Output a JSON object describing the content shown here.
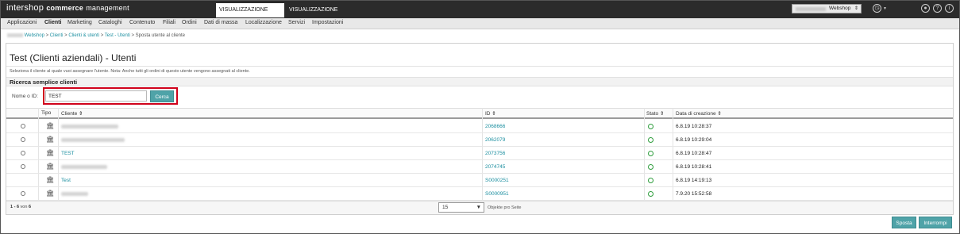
{
  "header": {
    "brand_part1": "intershop",
    "brand_part2": "commerce",
    "brand_part3": "management",
    "tab_data": "VISUALIZZAZIONE DATI",
    "tab_design": "VISUALIZZAZIONE DESIGN",
    "site_select_value": "Webshop",
    "icons": [
      "clock-icon",
      "user-icon",
      "help-icon",
      "info-icon"
    ]
  },
  "nav": {
    "items": [
      "Applicazioni",
      "Clienti",
      "Marketing",
      "Cataloghi",
      "Contenuto",
      "Filiali",
      "Ordini",
      "Dati di massa",
      "Localizzazione",
      "Servizi",
      "Impostazioni"
    ],
    "active": "Clienti"
  },
  "breadcrumb": {
    "items": [
      "Webshop",
      "Clienti",
      "Clienti & utenti",
      "Test - Utenti"
    ],
    "current": "Sposta utente al cliente",
    "sep": ">"
  },
  "page": {
    "title": "Test (Clienti aziendali) - Utenti",
    "hint": "Seleziona il cliente al quale vuoi assegnare l'utente. Nota: Anche tutti gli ordini di questo utente vengono assegnati al cliente."
  },
  "search": {
    "section_title": "Ricerca semplice clienti",
    "label": "Nome o ID:",
    "value": "TEST",
    "button": "Cerca"
  },
  "table": {
    "headers": {
      "tipo": "Tipo",
      "cliente": "Cliente ⇕",
      "id": "ID ⇕",
      "stato": "Stato ⇕",
      "data": "Data di creazione ⇕"
    },
    "rows": [
      {
        "radio": true,
        "cliente": "",
        "id": "2068666",
        "date": "6.8.19 10:28:37"
      },
      {
        "radio": true,
        "cliente": "",
        "id": "2062079",
        "date": "6.8.19 10:29:04"
      },
      {
        "radio": true,
        "cliente": "TEST",
        "id": "2073756",
        "date": "6.8.19 10:28:47"
      },
      {
        "radio": true,
        "cliente": "",
        "id": "2074745",
        "date": "6.8.19 10:28:41"
      },
      {
        "radio": false,
        "cliente": "Test",
        "id": "S0000251",
        "date": "6.8.19 14:19:13"
      },
      {
        "radio": true,
        "cliente": "",
        "id": "S0000951",
        "date": "7.9.20 15:52:58"
      }
    ]
  },
  "pagination": {
    "range": "1 - 6",
    "of": "von",
    "total": "6",
    "per_page": "15",
    "per_page_label": "Objekte pro Seite"
  },
  "actions": {
    "move": "Sposta",
    "cancel": "Interrompi"
  },
  "colors": {
    "header_bg": "#2b2b2b",
    "link": "#1c8fa0",
    "button": "#4fa3a8",
    "status_ok": "#2e9d3c",
    "highlight": "#d0021b"
  }
}
